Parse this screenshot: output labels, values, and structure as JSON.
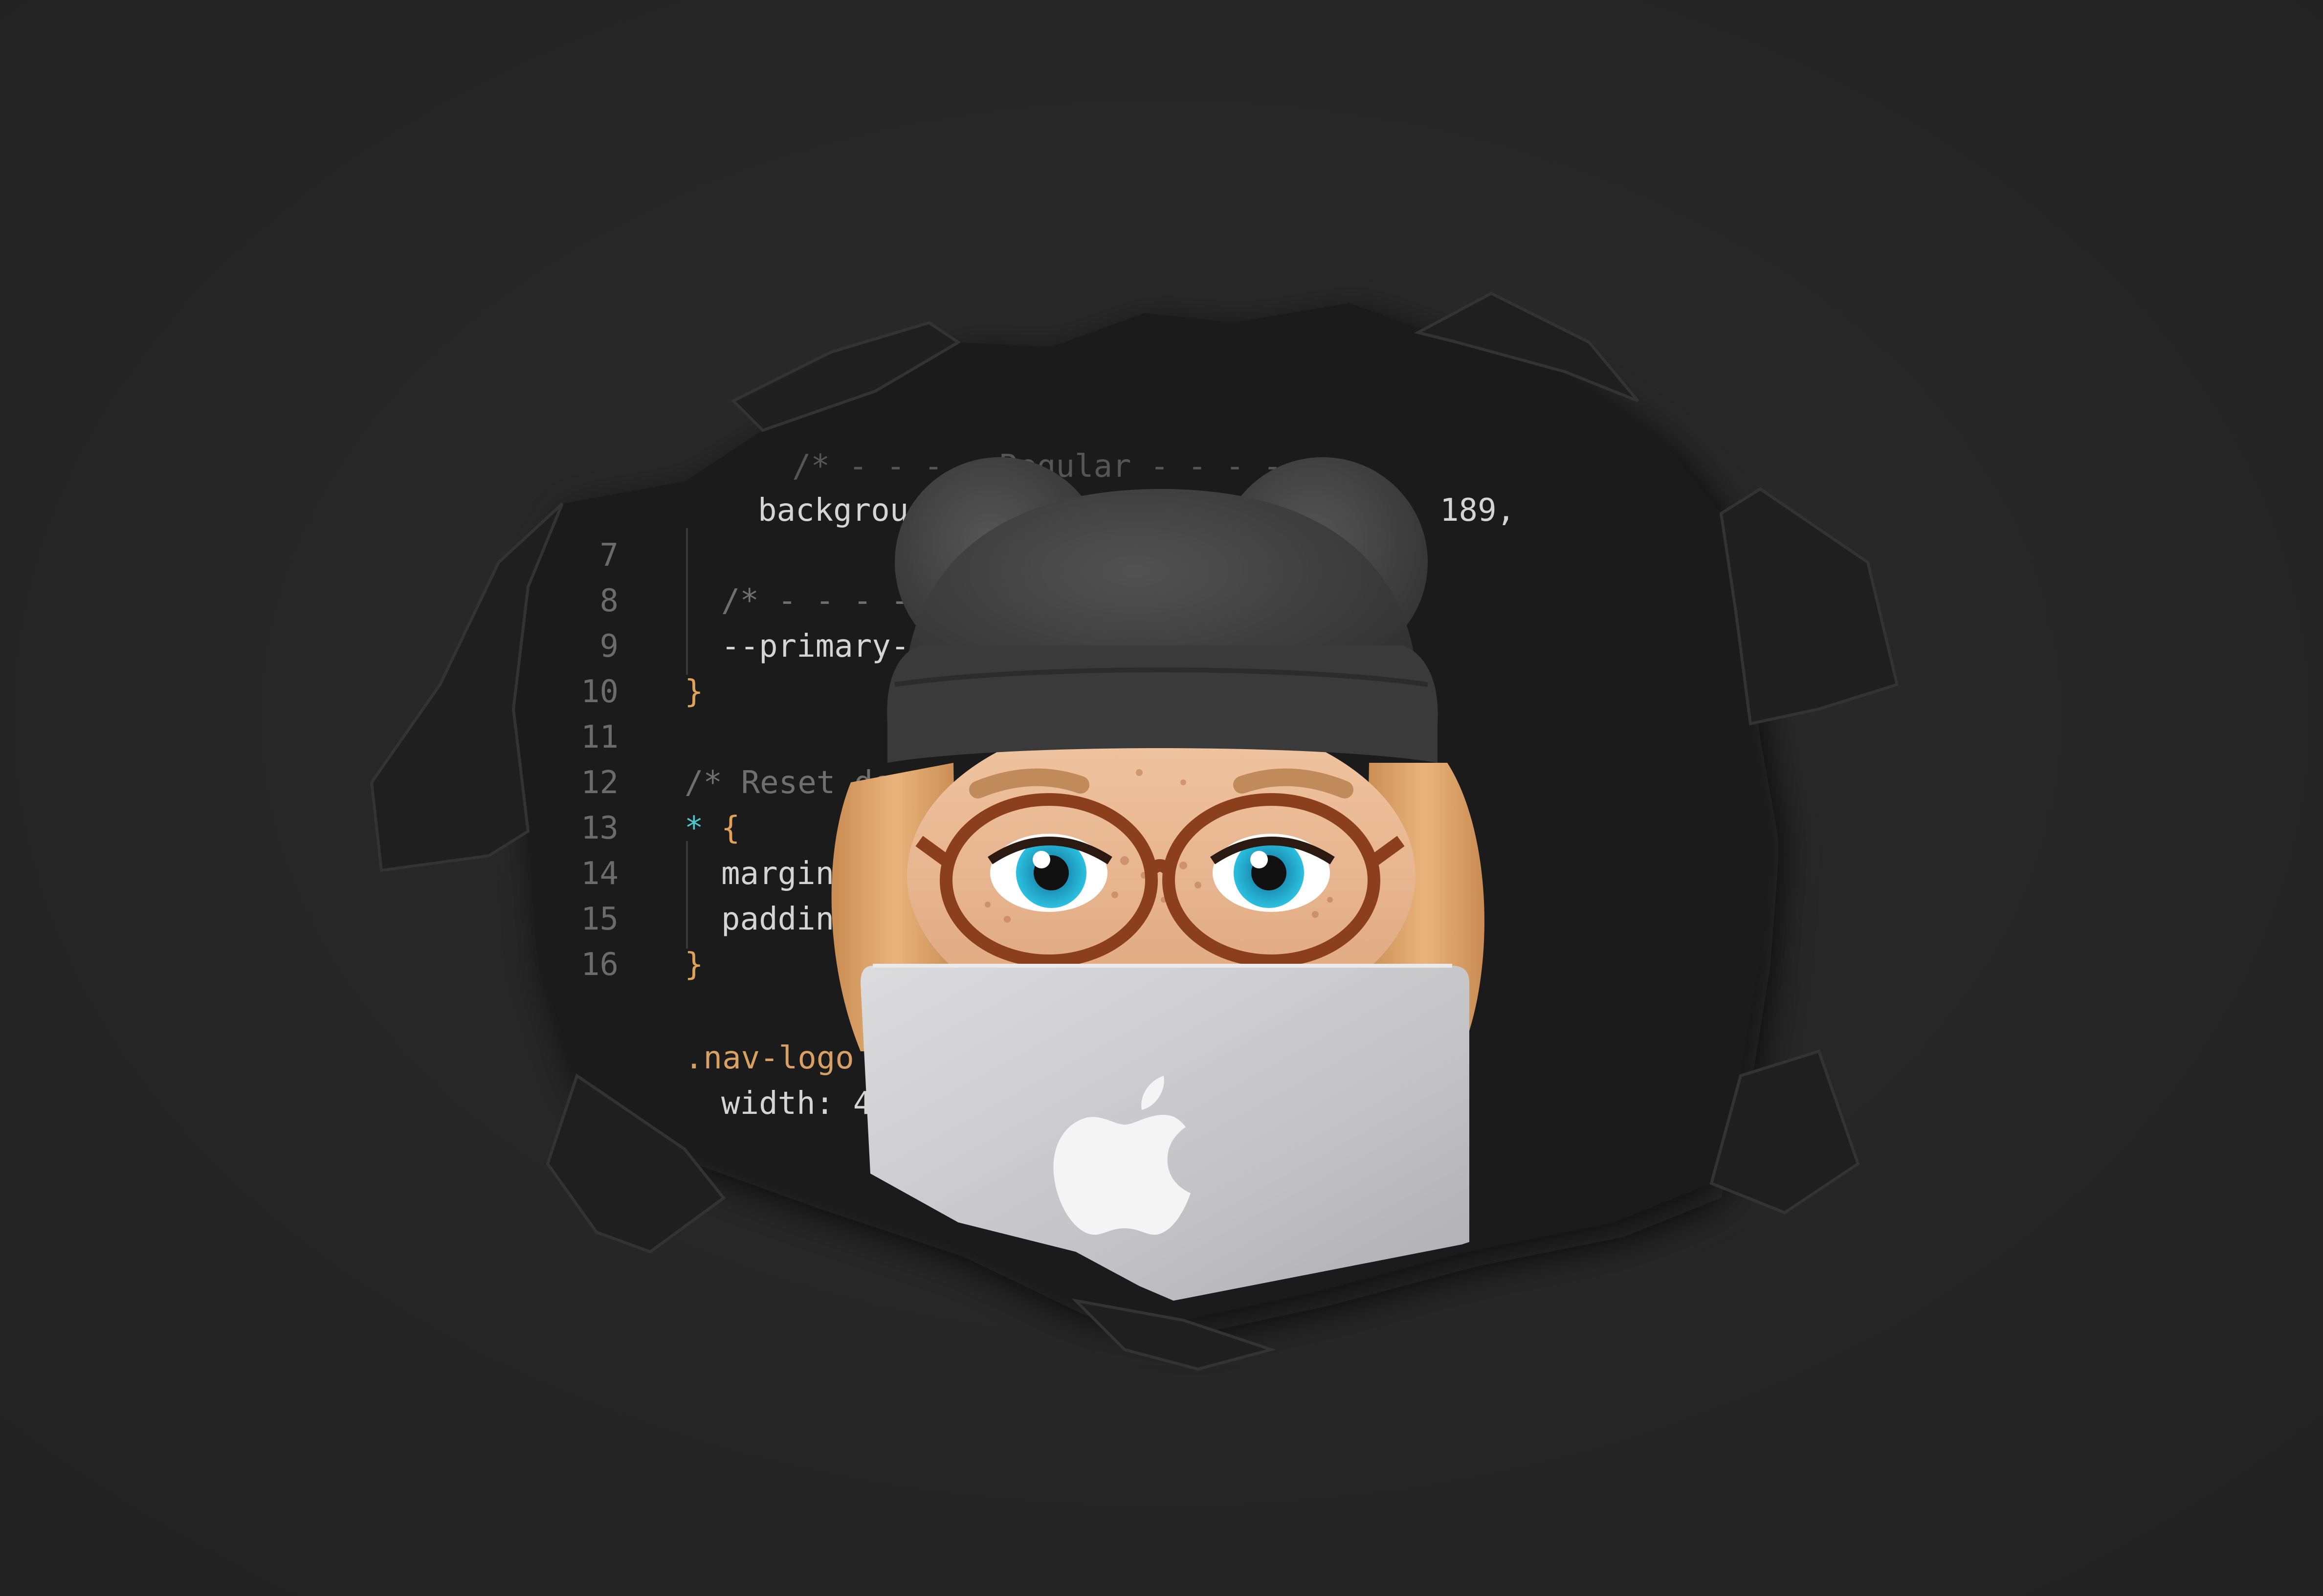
{
  "palette": {
    "wall": "#262626",
    "wall_shadow": "#1c1c1c",
    "editor_bg": "#1c1c1c",
    "gutter": "#6b6b6b",
    "code_text": "#d4d4d4",
    "comment": "#6f6f6f",
    "brace": "#e0a15a",
    "selector_star": "#4fc7c9",
    "class_selector": "#d9a066",
    "beanie": "#3d3d3d",
    "skin": "#e5b48f",
    "hair": "#e0a66c",
    "glasses": "#8b3f1c",
    "iris": "#2bb3d8",
    "laptop": "#cfcfd1",
    "apple_logo": "#f4f4f4"
  },
  "editor": {
    "top_fragments": {
      "comment": "/* - - - - Regular - - - - - -",
      "property_partial": "backgrou",
      "value_partial": "189,"
    },
    "lines": [
      {
        "number": "7",
        "text": ""
      },
      {
        "number": "8",
        "text": "/* - - - -"
      },
      {
        "number": "9",
        "text": "--primary-f"
      },
      {
        "number": "10",
        "text": "}"
      },
      {
        "number": "11",
        "text": ""
      },
      {
        "number": "12",
        "text": "/* Reset de"
      },
      {
        "number": "13",
        "text_star": "*",
        "text_brace": "{"
      },
      {
        "number": "14",
        "text": "margin:"
      },
      {
        "number": "15",
        "text": "paddin"
      },
      {
        "number": "16",
        "text": "}"
      }
    ],
    "trailing": {
      "selector": ".nav-logo",
      "property": "width: 4"
    }
  },
  "illustration": {
    "character": "memoji-peeking",
    "accessories": [
      "beanie-with-ears-icon",
      "round-glasses-icon",
      "laptop-icon",
      "apple-logo-icon"
    ]
  }
}
